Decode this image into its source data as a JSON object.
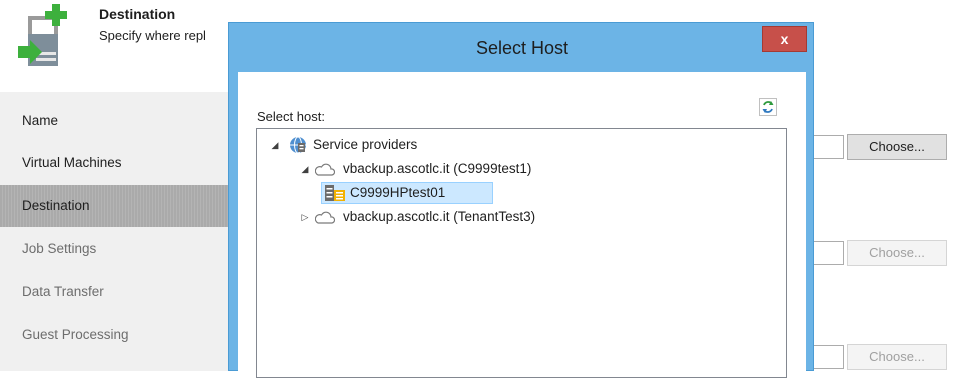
{
  "header": {
    "title": "Destination",
    "subtitle": "Specify where repl"
  },
  "nav": {
    "items": [
      {
        "label": "Name",
        "state": "enabled"
      },
      {
        "label": "Virtual Machines",
        "state": "enabled"
      },
      {
        "label": "Destination",
        "state": "active"
      },
      {
        "label": "Job Settings",
        "state": "disabled"
      },
      {
        "label": "Data Transfer",
        "state": "enabled"
      },
      {
        "label": "Guest Processing",
        "state": "enabled"
      }
    ]
  },
  "right": {
    "choose_buttons": [
      {
        "label": "Choose...",
        "enabled": true
      },
      {
        "label": "Choose...",
        "enabled": false
      },
      {
        "label": "Choose...",
        "enabled": false
      }
    ]
  },
  "dialog": {
    "title": "Select Host",
    "close_label": "x",
    "select_label": "Select host:",
    "tree": {
      "root": {
        "label": "Service providers",
        "icon": "service-providers-icon",
        "expanded": true
      },
      "providers": [
        {
          "label": "vbackup.ascotlc.it (C9999test1)",
          "icon": "cloud-icon",
          "expanded": true,
          "children": [
            {
              "label": "C9999HPtest01",
              "icon": "host-icon",
              "selected": true
            }
          ]
        },
        {
          "label": "vbackup.ascotlc.it (TenantTest3)",
          "icon": "cloud-icon",
          "expanded": false
        }
      ]
    }
  },
  "colors": {
    "dialog_frame": "#6cb4e6",
    "close_button": "#c7504a",
    "selection": "#cce8ff",
    "nav_active": "#aaaaaa",
    "left_panel": "#f0f0f0"
  }
}
